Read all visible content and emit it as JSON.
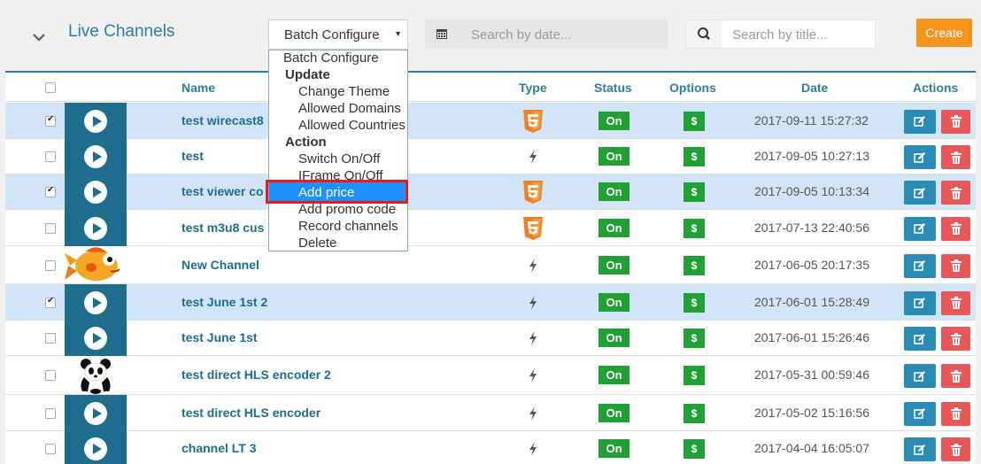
{
  "header": {
    "title": "Live Channels",
    "batch_label": "Batch Configure",
    "date_search_placeholder": "Search by date...",
    "title_search_placeholder": "Search by title...",
    "create_label": "Create"
  },
  "columns": [
    "Name",
    "Type",
    "Status",
    "Options",
    "Date",
    "Actions"
  ],
  "rows": [
    {
      "name": "test wirecast8",
      "type": "html5",
      "status": "On",
      "option": "$",
      "date": "2017-09-11 15:27:32",
      "checked": true,
      "thumb": "play"
    },
    {
      "name": "test",
      "type": "bolt",
      "status": "On",
      "option": "$",
      "date": "2017-09-05 10:27:13",
      "checked": false,
      "thumb": "play"
    },
    {
      "name": "test viewer co",
      "type": "html5",
      "status": "On",
      "option": "$",
      "date": "2017-09-05 10:13:34",
      "checked": true,
      "thumb": "play"
    },
    {
      "name": "test m3u8 cus",
      "type": "html5",
      "status": "On",
      "option": "$",
      "date": "2017-07-13 22:40:56",
      "checked": false,
      "thumb": "play"
    },
    {
      "name": "New Channel",
      "type": "bolt",
      "status": "On",
      "option": "$",
      "date": "2017-06-05 20:17:35",
      "checked": false,
      "thumb": "fish"
    },
    {
      "name": "test June 1st 2",
      "type": "bolt",
      "status": "On",
      "option": "$",
      "date": "2017-06-01 15:28:49",
      "checked": true,
      "thumb": "play"
    },
    {
      "name": "test June 1st",
      "type": "bolt",
      "status": "On",
      "option": "$",
      "date": "2017-06-01 15:26:46",
      "checked": false,
      "thumb": "play"
    },
    {
      "name": "test direct HLS encoder 2",
      "type": "bolt",
      "status": "On",
      "option": "$",
      "date": "2017-05-31 00:59:46",
      "checked": false,
      "thumb": "panda"
    },
    {
      "name": "test direct HLS encoder",
      "type": "bolt",
      "status": "On",
      "option": "$",
      "date": "2017-05-02 15:16:56",
      "checked": false,
      "thumb": "play"
    },
    {
      "name": "channel LT 3",
      "type": "bolt",
      "status": "On",
      "option": "$",
      "date": "2017-04-04 16:05:07",
      "checked": false,
      "thumb": "play"
    }
  ],
  "dropdown": {
    "items": [
      {
        "label": "Batch Configure",
        "kind": "option"
      },
      {
        "label": "Update",
        "kind": "group"
      },
      {
        "label": "Change Theme",
        "kind": "option"
      },
      {
        "label": "Allowed Domains",
        "kind": "option"
      },
      {
        "label": "Allowed Countries",
        "kind": "option"
      },
      {
        "label": "Action",
        "kind": "group"
      },
      {
        "label": "Switch On/Off",
        "kind": "option"
      },
      {
        "label": "IFrame On/Off",
        "kind": "option"
      },
      {
        "label": "Add price",
        "kind": "option",
        "highlighted": true
      },
      {
        "label": "Add promo code",
        "kind": "option"
      },
      {
        "label": "Record channels",
        "kind": "option"
      },
      {
        "label": "Delete",
        "kind": "option"
      }
    ]
  },
  "colors": {
    "accent": "#2a7fa1",
    "create": "#f7941d",
    "status_on": "#21a035",
    "edit": "#2a8cb5",
    "delete": "#e8585a",
    "selected_row": "#d1e5f6",
    "highlight": "#1e90ff",
    "highlight_frame": "#e2201a"
  },
  "icons": {
    "collapse": "chevron-down-icon",
    "date": "calendar-icon",
    "search": "search-icon",
    "html5": "html5-icon",
    "bolt": "bolt-icon",
    "edit": "edit-icon",
    "delete": "trash-icon"
  }
}
